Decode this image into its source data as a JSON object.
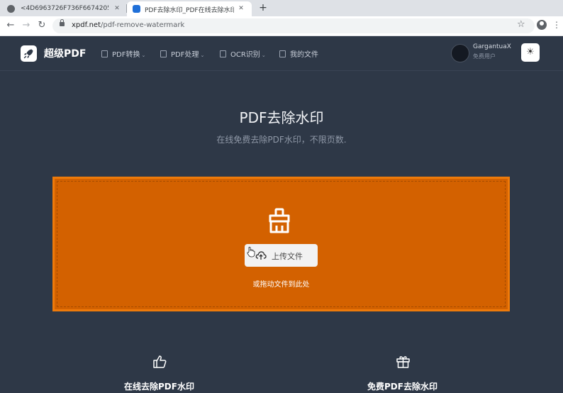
{
  "browser": {
    "tabs": [
      {
        "title": "<4D6963726F736F667420576F7"
      },
      {
        "title": "PDF去除水印_PDF在线去除水印"
      }
    ],
    "new_tab_label": "+",
    "url_host": "xpdf.net",
    "url_path": "/pdf-remove-watermark"
  },
  "nav": {
    "brand": "超级PDF",
    "items": [
      {
        "label": "PDF转换",
        "dropdown": true
      },
      {
        "label": "PDF处理",
        "dropdown": true
      },
      {
        "label": "OCR识别",
        "dropdown": true
      },
      {
        "label": "我的文件",
        "dropdown": false
      }
    ],
    "user_name": "GargantuaX",
    "user_role": "免费用户"
  },
  "main": {
    "title": "PDF去除水印",
    "subtitle": "在线免费去除PDF水印，不限页数.",
    "upload_label": "上传文件",
    "drop_hint": "或拖动文件到此处"
  },
  "features": [
    {
      "icon": "thumbs-up-icon",
      "label": "在线去除PDF水印"
    },
    {
      "icon": "gift-icon",
      "label": "免费PDF去除水印"
    }
  ],
  "colors": {
    "background": "#2e3847",
    "drop_zone": "#d36100",
    "drop_zone_border": "#ee7a0a",
    "accent_white": "#ffffff"
  }
}
